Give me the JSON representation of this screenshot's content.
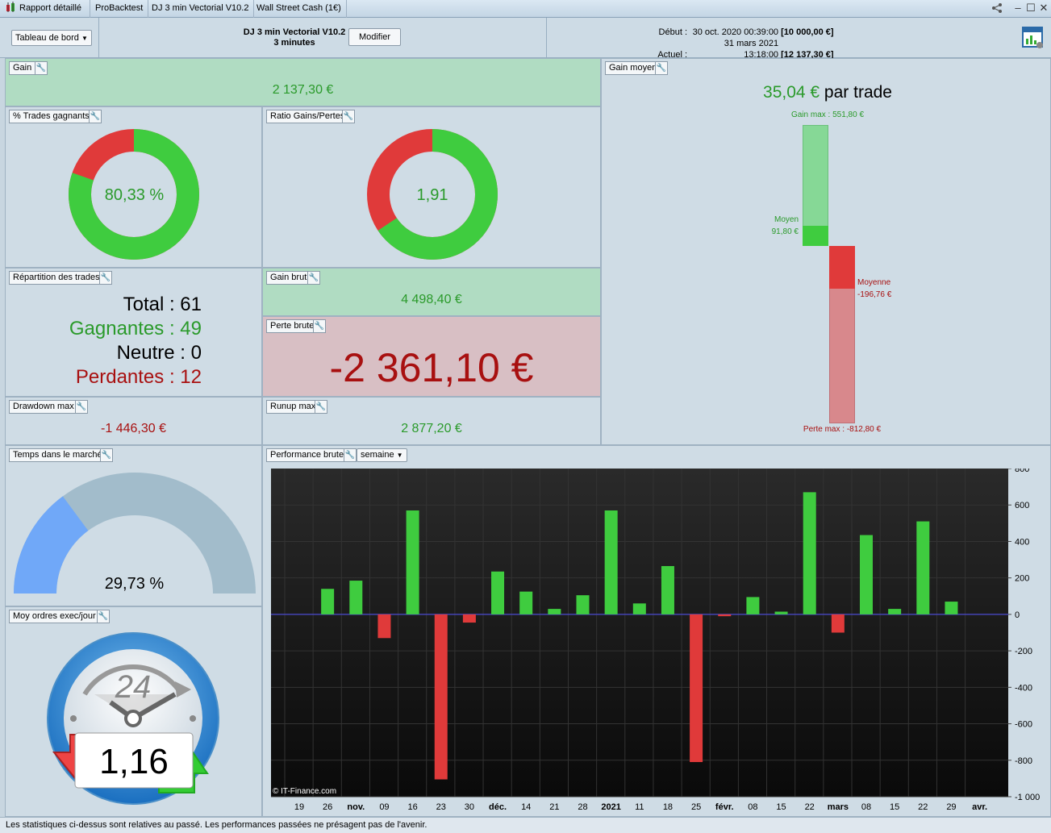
{
  "tabs": [
    {
      "label": "Rapport détaillé"
    },
    {
      "label": "ProBacktest"
    },
    {
      "label": "DJ 3 min Vectorial V10.2"
    },
    {
      "label": "Wall Street Cash (1€)"
    }
  ],
  "header": {
    "dashboard_label": "Tableau de bord",
    "strategy_name": "DJ 3 min Vectorial V10.2",
    "timeframe": "3 minutes",
    "modify_label": "Modifier",
    "start_label": "Début :",
    "start_date": "30 oct. 2020 00:39:00",
    "start_capital": "[10 000,00 €]",
    "current_label": "Actuel :",
    "current_date": "31 mars 2021 13:18:00",
    "current_capital": "[12 137,30 €]"
  },
  "gain": {
    "title": "Gain",
    "value": "2 137,30 €"
  },
  "win_pct": {
    "title": "% Trades gagnants",
    "value": "80,33 %",
    "fraction": 0.8033
  },
  "ratio": {
    "title": "Ratio Gains/Pertes",
    "value": "1,91",
    "fraction": 0.6563
  },
  "gain_moyen": {
    "title": "Gain moyen",
    "value": "35,04 €",
    "suffix": " par trade",
    "gain_max_label": "Gain max : 551,80 €",
    "moyen_label": "Moyen",
    "moyen_value": "91,80 €",
    "moyenne_label": "Moyenne",
    "moyenne_value": "-196,76 €",
    "perte_max_label": "Perte max : -812,80 €",
    "gain_max": 551.8,
    "gain_avg": 91.8,
    "loss_avg": -196.76,
    "loss_max": -812.8
  },
  "repartition": {
    "title": "Répartition des trades",
    "total_label": "Total :",
    "total": "61",
    "win_label": "Gagnantes :",
    "win": "49",
    "neutral_label": "Neutre :",
    "neutral": "0",
    "loss_label": "Perdantes :",
    "loss": "12"
  },
  "gain_brut": {
    "title": "Gain brut",
    "value": "4 498,40 €"
  },
  "perte_brute": {
    "title": "Perte brute",
    "value": "-2 361,10 €"
  },
  "drawdown": {
    "title": "Drawdown max",
    "value": "-1 446,30 €"
  },
  "runup": {
    "title": "Runup max",
    "value": "2 877,20 €"
  },
  "temps": {
    "title": "Temps dans le marché",
    "value": "29,73 %",
    "fraction": 0.2973
  },
  "ordres": {
    "title": "Moy ordres exec/jour",
    "value": "1,16",
    "clock_label": "24"
  },
  "performance": {
    "title": "Performance brute",
    "period": "semaine",
    "watermark": "© IT-Finance.com"
  },
  "chart_data": {
    "type": "bar",
    "categories": [
      "19",
      "26",
      "nov.",
      "09",
      "16",
      "23",
      "30",
      "déc.",
      "14",
      "21",
      "28",
      "2021",
      "11",
      "18",
      "25",
      "févr.",
      "08",
      "15",
      "22",
      "mars",
      "08",
      "15",
      "22",
      "29",
      "avr."
    ],
    "values": [
      null,
      140,
      185,
      -130,
      570,
      -905,
      -45,
      235,
      125,
      30,
      105,
      570,
      60,
      265,
      -810,
      -10,
      95,
      15,
      670,
      -100,
      435,
      30,
      510,
      70,
      null
    ],
    "ylim": [
      -1000,
      800
    ],
    "yticks": [
      800,
      600,
      400,
      200,
      0,
      -200,
      -400,
      -600,
      -800,
      -1000
    ],
    "ytick_labels": [
      "800",
      "600",
      "400",
      "200",
      "0",
      "-200",
      "-400",
      "-600",
      "-800",
      "-1 000"
    ],
    "bold_ticks": [
      "nov.",
      "déc.",
      "2021",
      "févr.",
      "mars",
      "avr."
    ],
    "colors": {
      "positive": "#3fcc3f",
      "negative": "#e03a3a",
      "background": "#111111",
      "zero": "#4a4ad0"
    }
  },
  "footer": {
    "text": "Les statistiques ci-dessus sont relatives au passé. Les performances passées ne présagent pas de l'avenir."
  },
  "colors": {
    "green_text": "#2a9a2a",
    "red_text": "#a81010",
    "green": "#3fcc3f",
    "red": "#e03a3a"
  }
}
